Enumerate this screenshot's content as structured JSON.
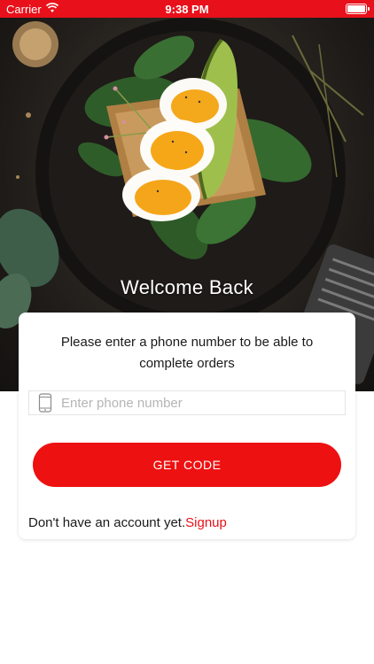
{
  "status_bar": {
    "carrier": "Carrier",
    "time": "9:38 PM"
  },
  "hero": {
    "welcome": "Welcome Back"
  },
  "card": {
    "message": "Please enter a phone number to be able to complete orders",
    "phone_placeholder": "Enter phone number",
    "get_code_label": "GET CODE",
    "no_account_text": "Don't have an account yet.",
    "signup_label": "Signup"
  },
  "colors": {
    "accent": "#e8101a",
    "button": "#ee1111"
  }
}
